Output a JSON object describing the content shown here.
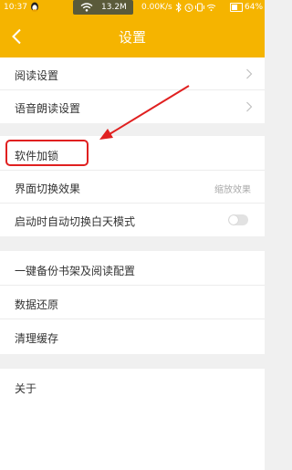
{
  "status_bar": {
    "time": "10:37",
    "data_size": "13.2M",
    "net_speed": "0.00K/s",
    "battery_percent": "64%",
    "battery_level": 0.64
  },
  "header": {
    "title": "设置"
  },
  "sections": [
    {
      "items": [
        {
          "label": "阅读设置"
        },
        {
          "label": "语音朗读设置"
        }
      ]
    },
    {
      "items": [
        {
          "label": "软件加锁"
        },
        {
          "label": "界面切换效果",
          "value": "缩放效果"
        },
        {
          "label": "启动时自动切换白天模式"
        }
      ]
    },
    {
      "items": [
        {
          "label": "一键备份书架及阅读配置"
        },
        {
          "label": "数据还原"
        },
        {
          "label": "清理缓存"
        }
      ]
    },
    {
      "items": [
        {
          "label": "关于"
        }
      ]
    }
  ],
  "colors": {
    "accent": "#f5b400",
    "annotation": "#e02020"
  }
}
